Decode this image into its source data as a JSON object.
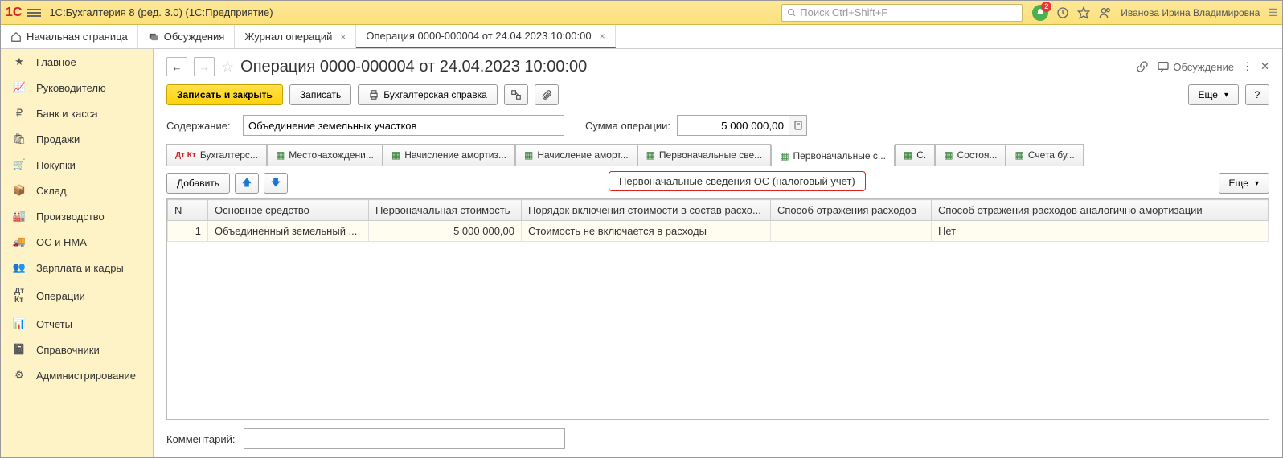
{
  "app": {
    "title": "1С:Бухгалтерия 8 (ред. 3.0)  (1С:Предприятие)"
  },
  "search": {
    "placeholder": "Поиск Ctrl+Shift+F"
  },
  "notifications": {
    "count": "2"
  },
  "user": {
    "name": "Иванова Ирина Владимировна"
  },
  "mainTabs": {
    "home": "Начальная страница",
    "discussions": "Обсуждения",
    "journal": "Журнал операций",
    "operation": "Операция 0000-000004 от 24.04.2023 10:00:00"
  },
  "sidebar": {
    "items": [
      "Главное",
      "Руководителю",
      "Банк и касса",
      "Продажи",
      "Покупки",
      "Склад",
      "Производство",
      "ОС и НМА",
      "Зарплата и кадры",
      "Операции",
      "Отчеты",
      "Справочники",
      "Администрирование"
    ]
  },
  "document": {
    "title": "Операция 0000-000004 от 24.04.2023 10:00:00"
  },
  "headerActions": {
    "discussion": "Обсуждение"
  },
  "toolbar": {
    "save_close": "Записать и закрыть",
    "save": "Записать",
    "print_ref": "Бухгалтерская справка",
    "more": "Еще",
    "help": "?"
  },
  "form": {
    "content_label": "Содержание:",
    "content_value": "Объединение земельных участков",
    "sum_label": "Сумма операции:",
    "sum_value": "5 000 000,00"
  },
  "docTabs": [
    "Бухгалтерс...",
    "Местонахождени...",
    "Начисление амортиз...",
    "Начисление аморт...",
    "Первоначальные све...",
    "Первоначальные с...",
    "С.",
    "Состоя...",
    "Счета бу..."
  ],
  "tableToolbar": {
    "add": "Добавить",
    "more": "Еще"
  },
  "callout": {
    "text": "Первоначальные сведения ОС (налоговый учет)"
  },
  "table": {
    "headers": {
      "n": "N",
      "asset": "Основное средство",
      "cost": "Первоначальная стоимость",
      "order": "Порядок включения стоимости в состав расхо...",
      "method": "Способ отражения расходов",
      "method_like": "Способ отражения расходов аналогично амортизации"
    },
    "row": {
      "n": "1",
      "asset": "Объединенный земельный ...",
      "cost": "5 000 000,00",
      "order": "Стоимость не включается в расходы",
      "method": "",
      "method_like": "Нет"
    }
  },
  "comment": {
    "label": "Комментарий:",
    "value": ""
  }
}
